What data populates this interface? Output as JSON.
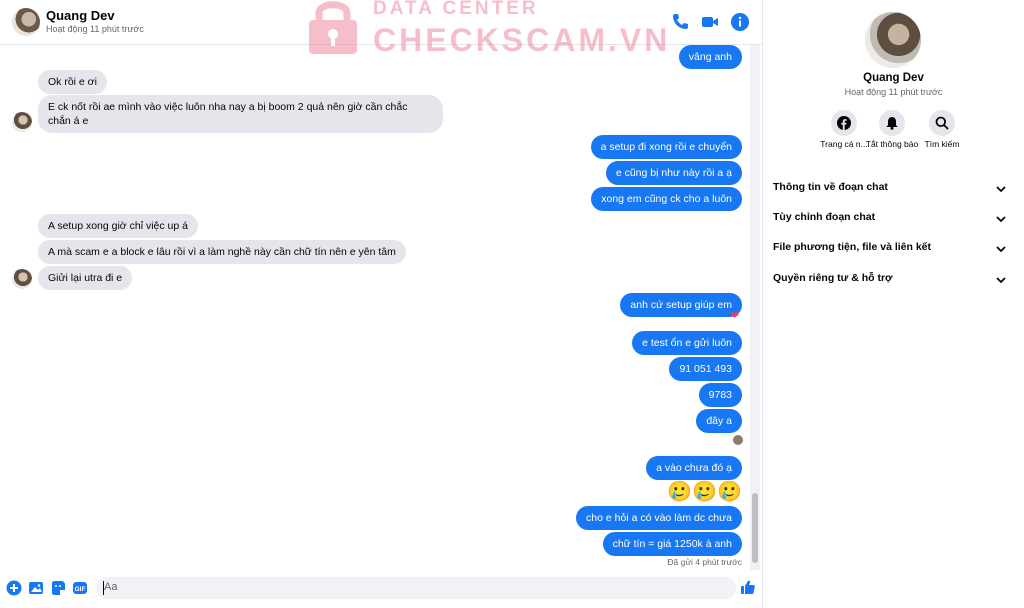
{
  "header": {
    "name": "Quang Dev",
    "status": "Hoạt động 11 phút trước",
    "icons": [
      "phone-icon",
      "video-icon",
      "info-icon"
    ],
    "accent": "#1877f2"
  },
  "watermark": {
    "line1": "DATA CENTER",
    "line2": "CHECKSCAM.VN",
    "color": "#f08aa0"
  },
  "messages": [
    {
      "dir": "out",
      "text": "vâng anh"
    },
    {
      "dir": "in",
      "text": "Ok rồi e ơi"
    },
    {
      "dir": "in",
      "text": "E ck nốt rồi ae mình vào việc luôn nha nay a bị boom 2 quả nên giờ cần chắc chắn á e"
    },
    {
      "dir": "out",
      "text": "a setup đi xong rồi e chuyển"
    },
    {
      "dir": "out",
      "text": "e cũng bị như này rồi a ạ"
    },
    {
      "dir": "out",
      "text": "xong em cũng ck cho a luôn"
    },
    {
      "dir": "in",
      "text": "A setup xong giờ chỉ việc up á"
    },
    {
      "dir": "in",
      "text": "A mà scam e a block e lâu rồi vì a làm nghề này cần chữ tín nên e yên tâm"
    },
    {
      "dir": "in",
      "text": "Giửi lại utra đi e"
    },
    {
      "dir": "out",
      "text": "anh cứ setup giúp em",
      "reaction": "❤"
    },
    {
      "dir": "out",
      "text": "e test ổn e gửi luôn"
    },
    {
      "dir": "out",
      "text": "91 051 493"
    },
    {
      "dir": "out",
      "text": "9783"
    },
    {
      "dir": "out",
      "text": "đây a"
    },
    {
      "dir": "out",
      "text": "a vào chưa đó ạ"
    },
    {
      "dir": "out",
      "text": "🥲🥲🥲",
      "emoji": true
    },
    {
      "dir": "out",
      "text": "cho e hỏi a có vào làm dc chưa"
    },
    {
      "dir": "out",
      "text": "chữ tín = giá 1250k à anh"
    }
  ],
  "sent_status": "Đã gửi 4 phút trước",
  "composer": {
    "placeholder": "Aa",
    "icons": [
      "plus-icon",
      "image-icon",
      "sticker-icon",
      "gif-icon",
      "emoji-icon",
      "like-icon"
    ]
  },
  "sidebar": {
    "name": "Quang Dev",
    "status": "Hoạt động 11 phút trước",
    "actions": [
      {
        "label": "Trang cá n...",
        "icon": "facebook-icon"
      },
      {
        "label": "Tắt thông báo",
        "icon": "bell-icon"
      },
      {
        "label": "Tìm kiếm",
        "icon": "search-icon"
      }
    ],
    "sections": [
      "Thông tin về đoạn chat",
      "Tùy chỉnh đoạn chat",
      "File phương tiện, file và liên kết",
      "Quyền riêng tư & hỗ trợ"
    ]
  }
}
